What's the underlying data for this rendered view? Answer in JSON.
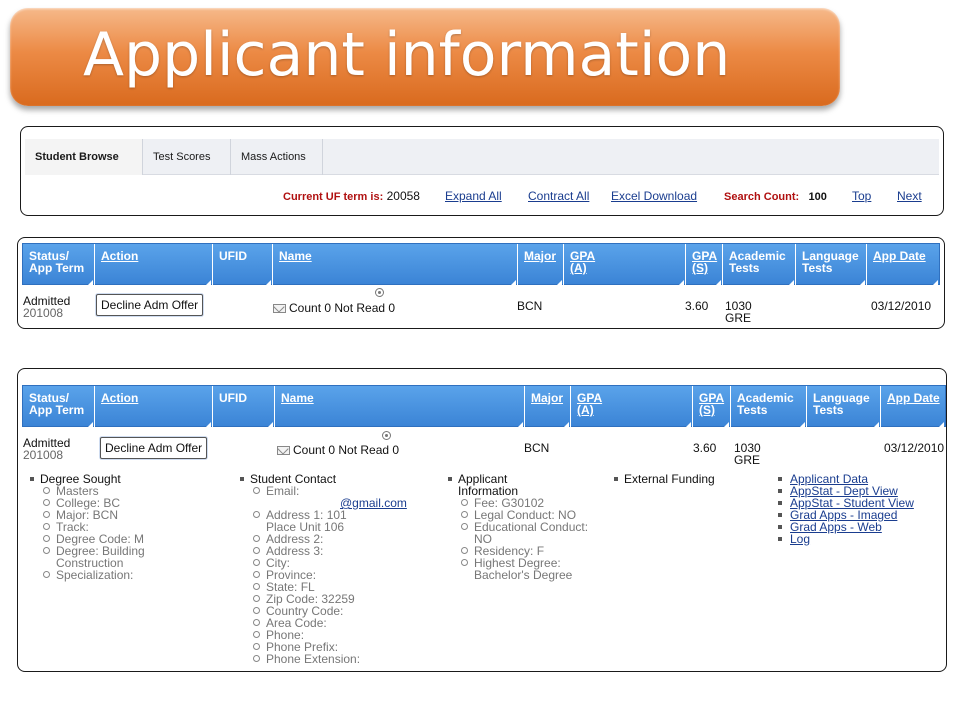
{
  "title": "Applicant information",
  "tabs": [
    "Student Browse",
    "Test Scores",
    "Mass Actions"
  ],
  "toolbar": {
    "term_label": "Current UF term is:",
    "term_value": "20058",
    "expand_all": "Expand All",
    "contract_all": "Contract All",
    "excel_download": "Excel Download",
    "search_count_label": "Search Count:",
    "search_count_value": "100",
    "top": "Top",
    "next": "Next"
  },
  "grid": {
    "headers": {
      "status_l1": "Status/",
      "status_l2": "App Term",
      "action": "Action",
      "ufid": "UFID",
      "name": "Name",
      "major": "Major",
      "gpa_a_l1": "GPA",
      "gpa_a_l2": "(A)",
      "gpa_s_l1": "GPA",
      "gpa_s_l2": "(S)",
      "academic_l1": "Academic",
      "academic_l2": "Tests",
      "language_l1": "Language",
      "language_l2": "Tests",
      "app_date": "App Date"
    },
    "row": {
      "status": "Admitted",
      "term": "201008",
      "action_button": "Decline Adm Offer",
      "name_text": "Count 0 Not Read 0",
      "major": "BCN",
      "gpa_s": "3.60",
      "academic_score": "1030",
      "academic_test": "GRE",
      "app_date": "03/12/2010"
    }
  },
  "details": {
    "degree": {
      "heading": "Degree Sought",
      "items": [
        "Masters",
        "College: BC",
        "Major: BCN",
        "Track:",
        "Degree Code: M",
        "Degree: Building",
        "Construction",
        "Specialization:"
      ]
    },
    "contact": {
      "heading": "Student Contact",
      "email_label": "Email:",
      "email_value": "@gmail.com",
      "address1": "Address 1: 101",
      "address1_cont": "Place Unit 106",
      "items": [
        "Address 2:",
        "Address 3:",
        "City:",
        "Province:",
        "State: FL",
        "Zip Code: 32259",
        "Country Code:",
        "Area Code:",
        "Phone:",
        "Phone Prefix:",
        "Phone Extension:"
      ]
    },
    "applicant": {
      "heading_l1": "Applicant",
      "heading_l2": "Information",
      "fee": "Fee: G30102",
      "legal": "Legal Conduct: NO",
      "educational": "Educational Conduct:",
      "educational_cont": "NO",
      "residency": "Residency: F",
      "highest": "Highest Degree:",
      "highest_cont": "Bachelor's Degree"
    },
    "funding": {
      "heading": "External Funding"
    },
    "links": [
      "Applicant Data",
      "AppStat - Dept View",
      "AppStat - Student View",
      "Grad Apps - Imaged",
      "Grad Apps - Web",
      "Log"
    ]
  }
}
